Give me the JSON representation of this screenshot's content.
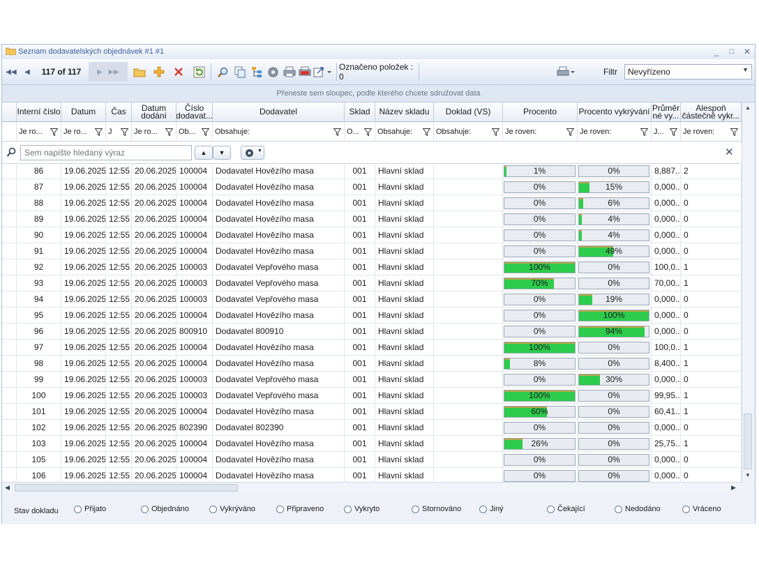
{
  "window": {
    "title": "Seznam dodavatelských objednávek #1 #1",
    "minimize": "_",
    "maximize": "□",
    "close": "✕"
  },
  "toolbar": {
    "record_counter": "117 of 117",
    "marked_items": "Označeno položek : 0",
    "filter_label": "Filtr",
    "filter_value": "Nevyřízeno"
  },
  "groupbar": {
    "hint": "Přeneste sem sloupec, podle kterého chcete sdružovat data"
  },
  "columns": [
    {
      "label": "Interní číslo",
      "filter": "Je ro..."
    },
    {
      "label": "Datum",
      "filter": "Je ro..."
    },
    {
      "label": "Čas",
      "filter": "J"
    },
    {
      "label": "Datum dodání",
      "filter": "Je ro..."
    },
    {
      "label": "Číslo dodavat...",
      "filter": "Ob..."
    },
    {
      "label": "Dodavatel",
      "filter": "Obsahuje:"
    },
    {
      "label": "Sklad",
      "filter": "O..."
    },
    {
      "label": "Název skladu",
      "filter": "Obsahuje:"
    },
    {
      "label": "Doklad (VS)",
      "filter": "Obsahuje:"
    },
    {
      "label": "Procento",
      "filter": "Je roven:"
    },
    {
      "label": "Procento vykrývání",
      "filter": "Je roven:"
    },
    {
      "label": "Průměr né vy...",
      "filter": "J..."
    },
    {
      "label": "Alespoň částečně vykr...",
      "filter": "Je roven:"
    }
  ],
  "search": {
    "placeholder": "Sem napište hledaný výraz"
  },
  "rows": [
    {
      "id": "86",
      "date": "19.06.2025",
      "time": "12:55",
      "delivery": "20.06.2025",
      "supplier_no": "100004",
      "supplier": "Dodavatel Hovězího masa",
      "store": "001",
      "store_name": "Hlavní sklad",
      "doc": "",
      "pct": 1,
      "pct_label": "1%",
      "cover": 0,
      "cover_label": "0%",
      "avg": "8,887...",
      "partial": "2"
    },
    {
      "id": "87",
      "date": "19.06.2025",
      "time": "12:55",
      "delivery": "20.06.2025",
      "supplier_no": "100004",
      "supplier": "Dodavatel Hovězího masa",
      "store": "001",
      "store_name": "Hlavní sklad",
      "doc": "",
      "pct": 0,
      "pct_label": "0%",
      "cover": 15,
      "cover_label": "15%",
      "avg": "0,000...",
      "partial": "0"
    },
    {
      "id": "88",
      "date": "19.06.2025",
      "time": "12:55",
      "delivery": "20.06.2025",
      "supplier_no": "100004",
      "supplier": "Dodavatel Hovězího masa",
      "store": "001",
      "store_name": "Hlavní sklad",
      "doc": "",
      "pct": 0,
      "pct_label": "0%",
      "cover": 6,
      "cover_label": "6%",
      "avg": "0,000...",
      "partial": "0"
    },
    {
      "id": "89",
      "date": "19.06.2025",
      "time": "12:55",
      "delivery": "20.06.2025",
      "supplier_no": "100004",
      "supplier": "Dodavatel Hovězího masa",
      "store": "001",
      "store_name": "Hlavní sklad",
      "doc": "",
      "pct": 0,
      "pct_label": "0%",
      "cover": 4,
      "cover_label": "4%",
      "avg": "0,000...",
      "partial": "0"
    },
    {
      "id": "90",
      "date": "19.06.2025",
      "time": "12:55",
      "delivery": "20.06.2025",
      "supplier_no": "100004",
      "supplier": "Dodavatel Hovězího masa",
      "store": "001",
      "store_name": "Hlavní sklad",
      "doc": "",
      "pct": 0,
      "pct_label": "0%",
      "cover": 4,
      "cover_label": "4%",
      "avg": "0,000...",
      "partial": "0"
    },
    {
      "id": "91",
      "date": "19.06.2025",
      "time": "12:55",
      "delivery": "20.06.2025",
      "supplier_no": "100004",
      "supplier": "Dodavatel Hovězího masa",
      "store": "001",
      "store_name": "Hlavní sklad",
      "doc": "",
      "pct": 0,
      "pct_label": "0%",
      "cover": 49,
      "cover_label": "49%",
      "avg": "0,000...",
      "partial": "0"
    },
    {
      "id": "92",
      "date": "19.06.2025",
      "time": "12:55",
      "delivery": "20.06.2025",
      "supplier_no": "100003",
      "supplier": "Dodavatel Vepřového masa",
      "store": "001",
      "store_name": "Hlavní sklad",
      "doc": "",
      "pct": 100,
      "pct_label": "100%",
      "cover": 0,
      "cover_label": "0%",
      "avg": "100,0...",
      "partial": "1"
    },
    {
      "id": "93",
      "date": "19.06.2025",
      "time": "12:55",
      "delivery": "20.06.2025",
      "supplier_no": "100003",
      "supplier": "Dodavatel Vepřového masa",
      "store": "001",
      "store_name": "Hlavní sklad",
      "doc": "",
      "pct": 70,
      "pct_label": "70%",
      "cover": 0,
      "cover_label": "0%",
      "avg": "70,00...",
      "partial": "1"
    },
    {
      "id": "94",
      "date": "19.06.2025",
      "time": "12:55",
      "delivery": "20.06.2025",
      "supplier_no": "100003",
      "supplier": "Dodavatel Vepřového masa",
      "store": "001",
      "store_name": "Hlavní sklad",
      "doc": "",
      "pct": 0,
      "pct_label": "0%",
      "cover": 19,
      "cover_label": "19%",
      "avg": "0,000...",
      "partial": "0"
    },
    {
      "id": "95",
      "date": "19.06.2025",
      "time": "12:55",
      "delivery": "20.06.2025",
      "supplier_no": "100004",
      "supplier": "Dodavatel Hovězího masa",
      "store": "001",
      "store_name": "Hlavní sklad",
      "doc": "",
      "pct": 0,
      "pct_label": "0%",
      "cover": 100,
      "cover_label": "100%",
      "avg": "0,000...",
      "partial": "0"
    },
    {
      "id": "96",
      "date": "19.06.2025",
      "time": "12:55",
      "delivery": "20.06.2025",
      "supplier_no": "800910",
      "supplier": "Dodavatel 800910",
      "store": "001",
      "store_name": "Hlavní sklad",
      "doc": "",
      "pct": 0,
      "pct_label": "0%",
      "cover": 94,
      "cover_label": "94%",
      "avg": "0,000...",
      "partial": "0"
    },
    {
      "id": "97",
      "date": "19.06.2025",
      "time": "12:55",
      "delivery": "20.06.2025",
      "supplier_no": "100004",
      "supplier": "Dodavatel Hovězího masa",
      "store": "001",
      "store_name": "Hlavní sklad",
      "doc": "",
      "pct": 100,
      "pct_label": "100%",
      "cover": 0,
      "cover_label": "0%",
      "avg": "100,0...",
      "partial": "1"
    },
    {
      "id": "98",
      "date": "19.06.2025",
      "time": "12:55",
      "delivery": "20.06.2025",
      "supplier_no": "100004",
      "supplier": "Dodavatel Hovězího masa",
      "store": "001",
      "store_name": "Hlavní sklad",
      "doc": "",
      "pct": 8,
      "pct_label": "8%",
      "cover": 0,
      "cover_label": "0%",
      "avg": "8,400...",
      "partial": "1"
    },
    {
      "id": "99",
      "date": "19.06.2025",
      "time": "12:55",
      "delivery": "20.06.2025",
      "supplier_no": "100003",
      "supplier": "Dodavatel Vepřového masa",
      "store": "001",
      "store_name": "Hlavní sklad",
      "doc": "",
      "pct": 0,
      "pct_label": "0%",
      "cover": 30,
      "cover_label": "30%",
      "avg": "0,000...",
      "partial": "0"
    },
    {
      "id": "100",
      "date": "19.06.2025",
      "time": "12:55",
      "delivery": "20.06.2025",
      "supplier_no": "100003",
      "supplier": "Dodavatel Vepřového masa",
      "store": "001",
      "store_name": "Hlavní sklad",
      "doc": "",
      "pct": 100,
      "pct_label": "100%",
      "cover": 0,
      "cover_label": "0%",
      "avg": "99,95...",
      "partial": "1"
    },
    {
      "id": "101",
      "date": "19.06.2025",
      "time": "12:55",
      "delivery": "20.06.2025",
      "supplier_no": "100004",
      "supplier": "Dodavatel Hovězího masa",
      "store": "001",
      "store_name": "Hlavní sklad",
      "doc": "",
      "pct": 60,
      "pct_label": "60%",
      "cover": 0,
      "cover_label": "0%",
      "avg": "60,41...",
      "partial": "1"
    },
    {
      "id": "102",
      "date": "19.06.2025",
      "time": "12:55",
      "delivery": "20.06.2025",
      "supplier_no": "802390",
      "supplier": "Dodavatel 802390",
      "store": "001",
      "store_name": "Hlavní sklad",
      "doc": "",
      "pct": 0,
      "pct_label": "0%",
      "cover": 0,
      "cover_label": "0%",
      "avg": "0,000...",
      "partial": "0"
    },
    {
      "id": "103",
      "date": "19.06.2025",
      "time": "12:55",
      "delivery": "20.06.2025",
      "supplier_no": "100004",
      "supplier": "Dodavatel Hovězího masa",
      "store": "001",
      "store_name": "Hlavní sklad",
      "doc": "",
      "pct": 26,
      "pct_label": "26%",
      "cover": 0,
      "cover_label": "0%",
      "avg": "25,75...",
      "partial": "1"
    },
    {
      "id": "105",
      "date": "19.06.2025",
      "time": "12:55",
      "delivery": "20.06.2025",
      "supplier_no": "100004",
      "supplier": "Dodavatel Hovězího masa",
      "store": "001",
      "store_name": "Hlavní sklad",
      "doc": "",
      "pct": 0,
      "pct_label": "0%",
      "cover": 0,
      "cover_label": "0%",
      "avg": "0,000...",
      "partial": "0"
    },
    {
      "id": "106",
      "date": "19.06.2025",
      "time": "12:55",
      "delivery": "20.06.2025",
      "supplier_no": "100004",
      "supplier": "Dodavatel Hovězího masa",
      "store": "001",
      "store_name": "Hlavní sklad",
      "doc": "",
      "pct": 0,
      "pct_label": "0%",
      "cover": 0,
      "cover_label": "0%",
      "avg": "0,000...",
      "partial": "0"
    }
  ],
  "status": {
    "label": "Stav dokladu",
    "options": [
      "Přijato",
      "Objednáno",
      "Vykrýváno",
      "Připraveno",
      "Vykryto",
      "Stornováno",
      "Jiný",
      "Čekající",
      "Nedodáno",
      "Vráceno"
    ]
  },
  "colors": {
    "progress_fill": "#2ecc4c",
    "progress_edge": "#b8a74a",
    "title_text": "#3a5f9e"
  }
}
